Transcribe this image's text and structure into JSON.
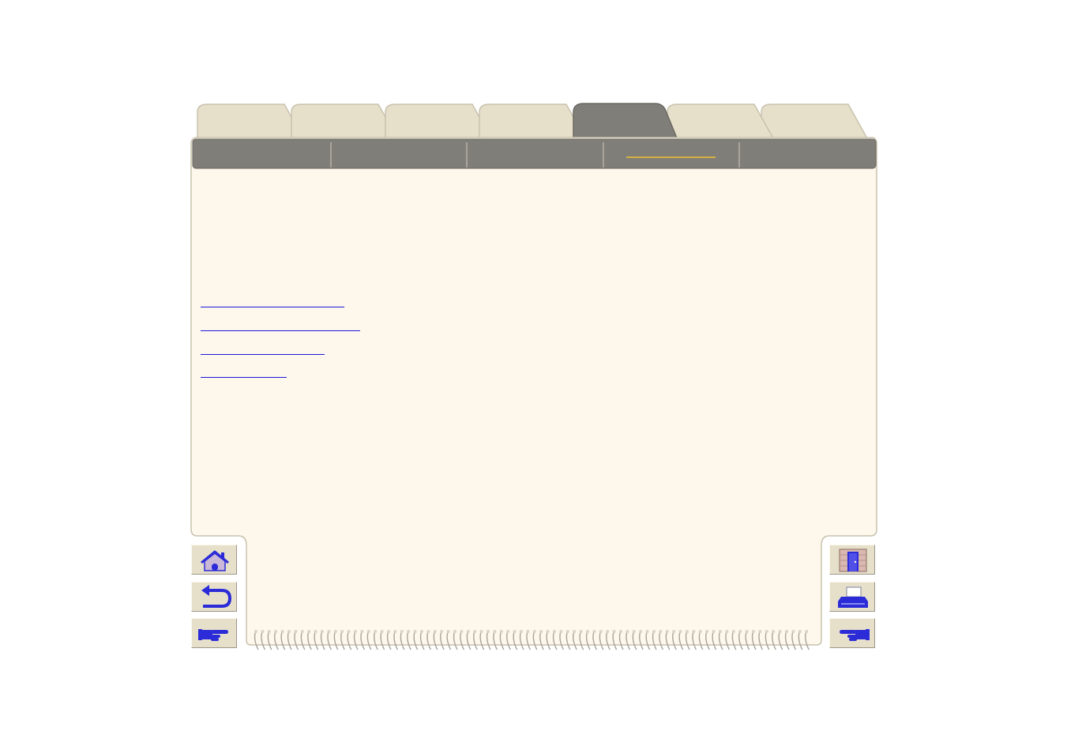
{
  "tabs": [
    {
      "label": "",
      "active": false
    },
    {
      "label": "",
      "active": false
    },
    {
      "label": "",
      "active": false
    },
    {
      "label": "",
      "active": false
    },
    {
      "label": "",
      "active": true
    },
    {
      "label": "",
      "active": false
    },
    {
      "label": "",
      "active": false
    }
  ],
  "subtabs": [
    {
      "label": "",
      "active": false
    },
    {
      "label": "",
      "active": false
    },
    {
      "label": "",
      "active": false
    },
    {
      "label": "",
      "active": true
    },
    {
      "label": "",
      "active": false
    }
  ],
  "links": [
    {
      "label": ""
    },
    {
      "label": ""
    },
    {
      "label": ""
    },
    {
      "label": ""
    }
  ],
  "left_nav": [
    {
      "icon": "home-icon"
    },
    {
      "icon": "back-arrow-icon"
    },
    {
      "icon": "hand-pointing-right-icon"
    }
  ],
  "right_nav": [
    {
      "icon": "exit-door-icon"
    },
    {
      "icon": "printer-icon"
    },
    {
      "icon": "hand-pointing-left-icon"
    }
  ],
  "colors": {
    "page": "#fdf7ec",
    "tab_inactive": "#e6e0ca",
    "tab_active": "#807e78",
    "subtab_bar": "#807e78",
    "subtab_active_underline": "#f0c030",
    "link": "#1a1adc",
    "icon_blue": "#2b2bd8"
  }
}
